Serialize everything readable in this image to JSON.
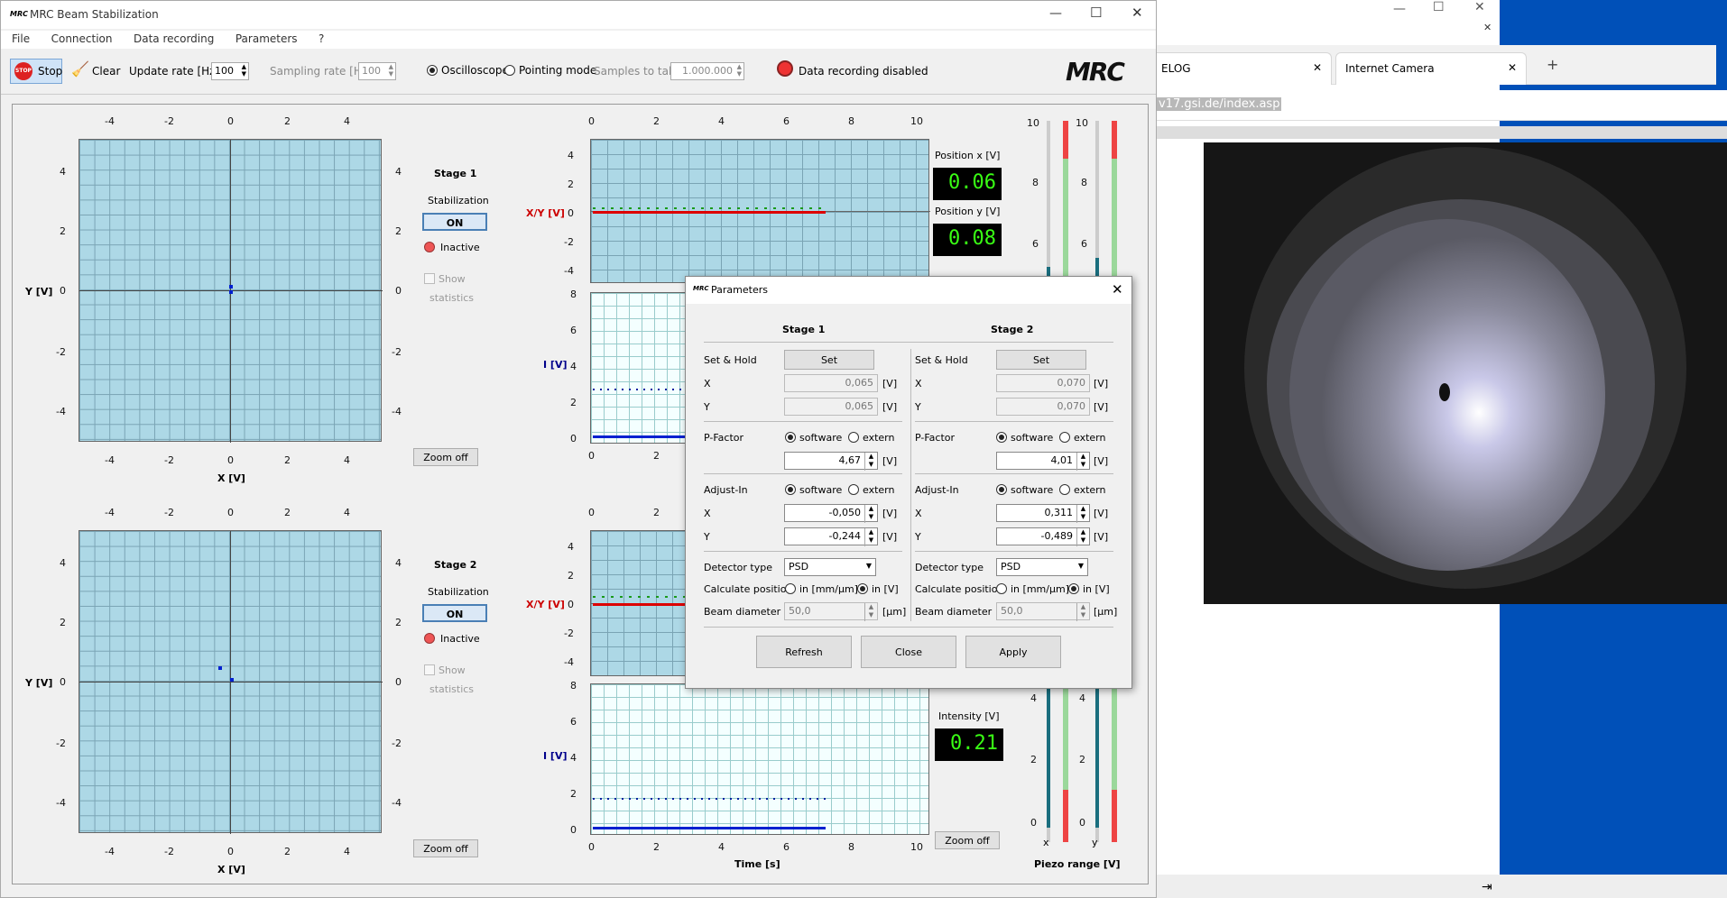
{
  "main": {
    "title": "MRC Beam Stabilization",
    "menu": [
      "File",
      "Connection",
      "Data recording",
      "Parameters",
      "?"
    ],
    "toolbar": {
      "stop": "Stop",
      "clear": "Clear",
      "update_rate_label": "Update rate [Hz]",
      "update_rate": "100",
      "sampling_rate_label": "Sampling rate [Hz]",
      "sampling_rate": "100",
      "oscilloscope": "Oscilloscope",
      "pointing_mode": "Pointing mode",
      "samples_label": "Samples to take",
      "samples": "1.000.000",
      "recording_status": "Data recording disabled",
      "logo": "MRC"
    },
    "xy_ticks": [
      "-4",
      "-2",
      "0",
      "2",
      "4"
    ],
    "stage1": {
      "title": "Stage 1",
      "stabilization": "Stabilization",
      "on": "ON",
      "status": "Inactive",
      "show": "Show",
      "statistics": "statistics",
      "zoom": "Zoom off",
      "xlabel": "X [V]",
      "ylabel": "Y [V]"
    },
    "stage2": {
      "title": "Stage 2",
      "stabilization": "Stabilization",
      "on": "ON",
      "status": "Inactive",
      "show": "Show",
      "statistics": "statistics",
      "zoom": "Zoom off",
      "xlabel": "X [V]",
      "ylabel": "Y [V]"
    },
    "time_ticks": [
      "0",
      "2",
      "4",
      "6",
      "8",
      "10"
    ],
    "time_label": "Time [s]",
    "xy_axis_label": "X/Y [V]",
    "i_axis_label": "I [V]",
    "pos_x_label": "Position x [V]",
    "pos_x": "0.06",
    "pos_y_label": "Position y [V]",
    "pos_y": "0.08",
    "intensity_label": "Intensity [V]",
    "intensity": "0.21",
    "zoom_right": "Zoom off",
    "piezo_label": "Piezo range [V]",
    "piezo_x": "x",
    "piezo_y": "y",
    "piezo_ticks_top": [
      "10",
      "8",
      "6"
    ],
    "piezo_ticks_bottom": [
      "4",
      "2",
      "0"
    ],
    "xy_yticks": [
      "4",
      "2",
      "0",
      "-2",
      "-4"
    ],
    "i_yticks": [
      "8",
      "6",
      "4",
      "2",
      "0"
    ]
  },
  "dialog": {
    "title": "Parameters",
    "stage1": "Stage 1",
    "stage2": "Stage 2",
    "set_hold": "Set & Hold",
    "set": "Set",
    "x": "X",
    "y": "Y",
    "unit_v": "[V]",
    "unit_um": "[µm]",
    "p_factor": "P-Factor",
    "adjust_in": "Adjust-In",
    "software": "software",
    "extern": "extern",
    "detector_type": "Detector type",
    "calc_pos": "Calculate position",
    "in_mm": "in [mm/µm]",
    "in_v": "in [V]",
    "beam_diameter": "Beam diameter",
    "s1": {
      "x": "0,065",
      "y": "0,065",
      "p": "4,67",
      "ax": "-0,050",
      "ay": "-0,244",
      "det": "PSD",
      "beam": "50,0"
    },
    "s2": {
      "x": "0,070",
      "y": "0,070",
      "p": "4,01",
      "ax": "0,311",
      "ay": "-0,489",
      "det": "PSD",
      "beam": "50,0"
    },
    "refresh": "Refresh",
    "close": "Close",
    "apply": "Apply"
  },
  "browser": {
    "tab1": "ELOG",
    "tab2": "Internet Camera",
    "url": "v17.gsi.de/index.asp"
  }
}
